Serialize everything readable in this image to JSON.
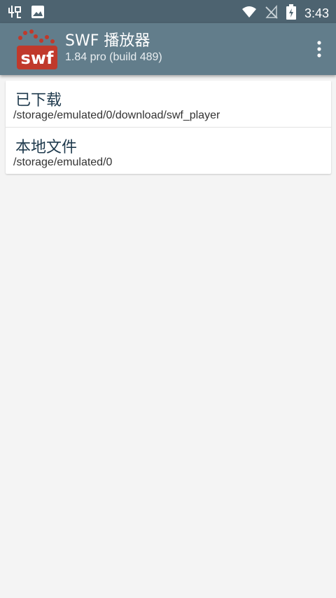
{
  "status_bar": {
    "time": "3:43",
    "left_icons": [
      "notification-icon",
      "image-icon"
    ],
    "right_icons": [
      "wifi-icon",
      "no-signal-icon",
      "battery-charging-icon"
    ]
  },
  "app_bar": {
    "logo_text": "swf",
    "title": "SWF 播放器",
    "subtitle": "1.84 pro (build 489)",
    "menu_icon": "overflow-menu-icon"
  },
  "locations": [
    {
      "title": "已下载",
      "path": "/storage/emulated/0/download/swf_player"
    },
    {
      "title": "本地文件",
      "path": "/storage/emulated/0"
    }
  ],
  "colors": {
    "status_bar": "#4d6370",
    "app_bar": "#627d8b",
    "background": "#f4f4f4",
    "logo_red": "#c0392b"
  }
}
